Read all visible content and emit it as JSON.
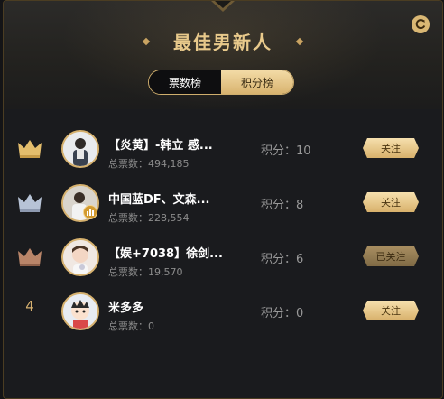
{
  "header": {
    "title": "最佳男新人",
    "refresh_icon": "refresh-icon",
    "accent_color": "#e8c98b"
  },
  "tabs": [
    {
      "label": "票数榜",
      "active": true
    },
    {
      "label": "积分榜",
      "active": false
    }
  ],
  "entries": [
    {
      "rank": 1,
      "rank_icon": "gold-crown-icon",
      "name": "【炎黄】-韩立 感...",
      "votes": "总票数：494,185",
      "score": "积分：10",
      "follow_label": "关注",
      "followed": false
    },
    {
      "rank": 2,
      "rank_icon": "silver-crown-icon",
      "name": "中国蓝DF、文森...",
      "votes": "总票数：228,554",
      "score": "积分：8",
      "follow_label": "关注",
      "followed": false,
      "badge_icon": "live-bars-icon"
    },
    {
      "rank": 3,
      "rank_icon": "bronze-crown-icon",
      "name": "【娱+7038】徐剑...",
      "votes": "总票数：19,570",
      "score": "积分：6",
      "follow_label": "已关注",
      "followed": true
    },
    {
      "rank": 4,
      "rank_label": "4",
      "name": "米多多",
      "votes": "总票数：0",
      "score": "积分：0",
      "follow_label": "关注",
      "followed": false
    }
  ],
  "colors": {
    "gold": "#e3bd6c",
    "silver": "#b7c3d6",
    "bronze": "#b98569"
  }
}
